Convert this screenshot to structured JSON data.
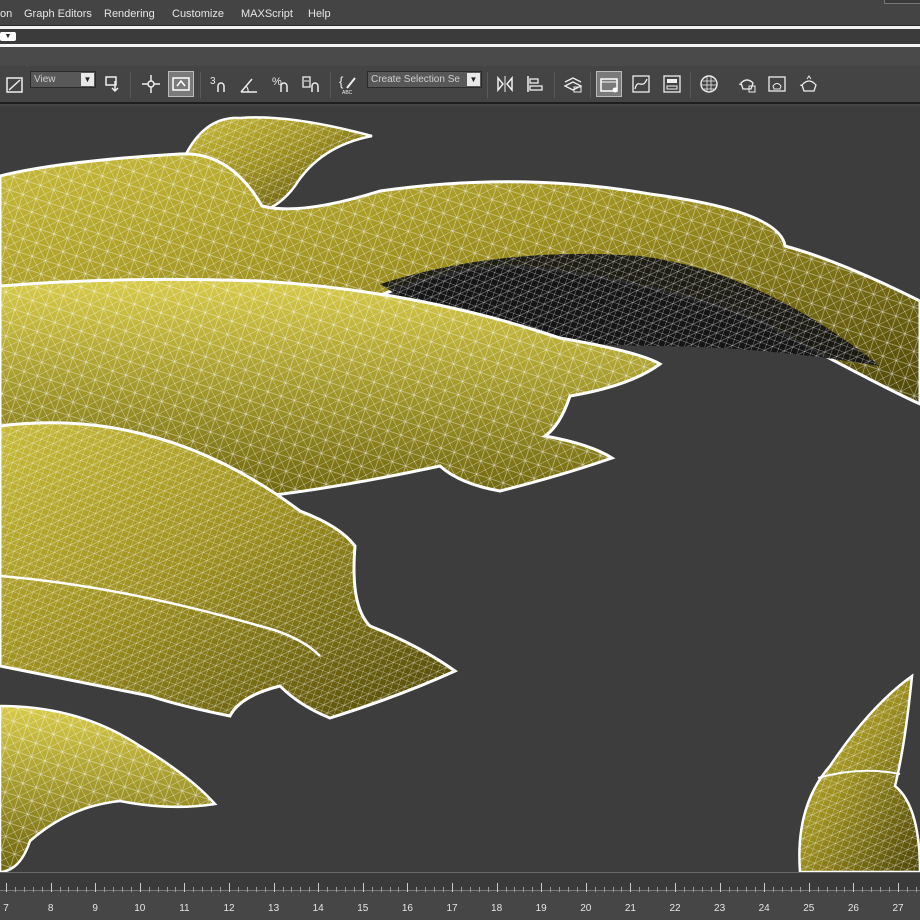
{
  "menu": {
    "items": [
      "on",
      "Graph Editors",
      "Rendering",
      "Customize",
      "MAXScript",
      "Help"
    ]
  },
  "toolbar": {
    "view_dropdown": "View",
    "selection_set_placeholder": "Create Selection Se",
    "icons": [
      "select-region-icon",
      "selection-filter-icon",
      "pivot-icon",
      "select-manipulate-icon",
      "keyboard-shortcut-override-icon",
      "snaps-toggle-icon",
      "angle-snap-icon",
      "percent-snap-icon",
      "spinner-snap-icon",
      "edit-named-sets-icon",
      "mirror-icon",
      "align-icon",
      "layer-manager-icon",
      "graphite-ribbon-icon",
      "curve-editor-icon",
      "schematic-view-icon",
      "material-editor-icon",
      "render-setup-icon",
      "rendered-frame-window-icon",
      "render-production-icon"
    ]
  },
  "timeline": {
    "ticks": [
      "7",
      "8",
      "9",
      "10",
      "11",
      "12",
      "13",
      "14",
      "15",
      "16",
      "17",
      "18",
      "19",
      "20",
      "21",
      "22",
      "23",
      "24",
      "25",
      "26",
      "27"
    ]
  },
  "viewport": {
    "object_color": "#9b8f1f",
    "wire_color": "#ffffff",
    "background_color": "#3d3d3d"
  }
}
